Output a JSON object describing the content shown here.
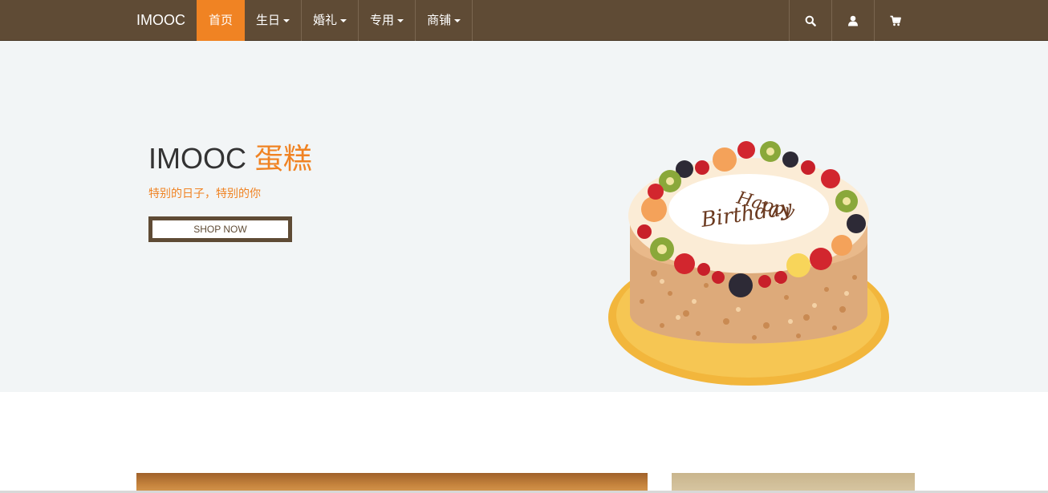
{
  "navbar": {
    "brand": "IMOOC",
    "items": [
      {
        "label": "首页",
        "active": true,
        "dropdown": false
      },
      {
        "label": "生日",
        "active": false,
        "dropdown": true
      },
      {
        "label": "婚礼",
        "active": false,
        "dropdown": true
      },
      {
        "label": "专用",
        "active": false,
        "dropdown": true
      },
      {
        "label": "商铺",
        "active": false,
        "dropdown": true
      }
    ],
    "icons": [
      "search-icon",
      "user-icon",
      "cart-icon"
    ]
  },
  "hero": {
    "title_main": "IMOOC ",
    "title_accent": "蛋糕",
    "subtitle": "特别的日子，特别的你",
    "button_label": "SHOP NOW",
    "cake_text_line1": "Happy",
    "cake_text_line2": "Birthday"
  },
  "colors": {
    "navbar_bg": "#5f4b35",
    "accent": "#f08323",
    "hero_bg": "#f2f5f6"
  }
}
